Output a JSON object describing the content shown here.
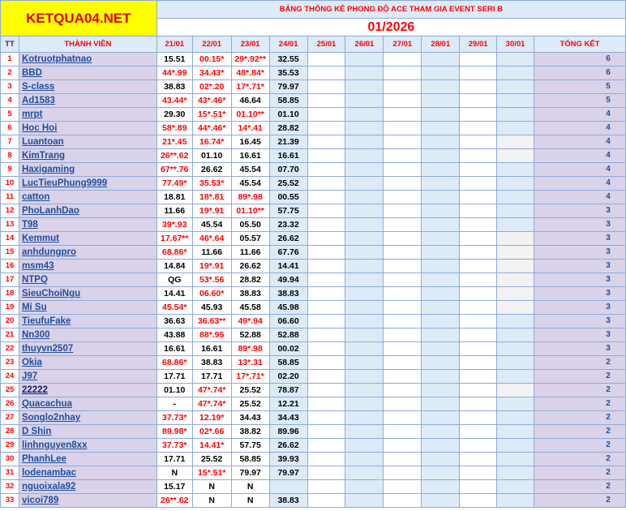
{
  "header": {
    "logo": "KETQUA04.NET",
    "title": "BẢNG THỐNG KÊ PHONG ĐỘ ACE THAM GIA EVENT SERI B",
    "month": "01/2026"
  },
  "columns": {
    "tt": "TT",
    "member": "THÀNH VIÊN",
    "dates": [
      "21/01",
      "22/01",
      "23/01",
      "24/01",
      "25/01",
      "26/01",
      "27/01",
      "28/01",
      "29/01",
      "30/01"
    ],
    "total": "TỔNG KẾT"
  },
  "rows": [
    {
      "tt": "1",
      "name": "Kotruotphatnao",
      "v": [
        "15.51",
        "00.15*",
        "29*.92**",
        "32.55"
      ],
      "total": "6"
    },
    {
      "tt": "2",
      "name": "BBD",
      "v": [
        "44*.99",
        "34.43*",
        "48*.84*",
        "35.53"
      ],
      "total": "6"
    },
    {
      "tt": "3",
      "name": "S-class",
      "v": [
        "38.83",
        "02*.20",
        "17*.71*",
        "79.97"
      ],
      "total": "5"
    },
    {
      "tt": "4",
      "name": "Ad1583",
      "v": [
        "43.44*",
        "43*.46*",
        "46.64",
        "58.85"
      ],
      "total": "5"
    },
    {
      "tt": "5",
      "name": "mrpt",
      "v": [
        "29.30",
        "15*.51*",
        "01.10**",
        "01.10"
      ],
      "total": "4"
    },
    {
      "tt": "6",
      "name": "Hoc Hoi",
      "v": [
        "58*.89",
        "44*.46*",
        "14*.41",
        "28.82"
      ],
      "total": "4"
    },
    {
      "tt": "7",
      "name": "Luantoan",
      "v": [
        "21*.45",
        "16.74*",
        "16.45",
        "21.39"
      ],
      "total": "4"
    },
    {
      "tt": "8",
      "name": "KimTrang",
      "v": [
        "26**.62",
        "01.10",
        "16.61",
        "16.61"
      ],
      "total": "4"
    },
    {
      "tt": "9",
      "name": "Haxigaming",
      "v": [
        "67**.76",
        "26.62",
        "45.54",
        "07.70"
      ],
      "total": "4"
    },
    {
      "tt": "10",
      "name": "LucTieuPhung9999",
      "v": [
        "77.49*",
        "35.53*",
        "45.54",
        "25.52"
      ],
      "total": "4"
    },
    {
      "tt": "11",
      "name": "catton",
      "v": [
        "18.81",
        "18*.81",
        "89*.98",
        "00.55"
      ],
      "total": "4"
    },
    {
      "tt": "12",
      "name": "PhoLanhDao",
      "v": [
        "11.66",
        "19*.91",
        "01.10**",
        "57.75"
      ],
      "total": "3"
    },
    {
      "tt": "13",
      "name": "T98",
      "v": [
        "39*.93",
        "45.54",
        "05.50",
        "23.32"
      ],
      "total": "3"
    },
    {
      "tt": "14",
      "name": "Kemmut",
      "v": [
        "17.67**",
        "46*.64",
        "05.57",
        "26.62"
      ],
      "total": "3"
    },
    {
      "tt": "15",
      "name": "anhdungpro",
      "v": [
        "68.86*",
        "11.66",
        "11.66",
        "67.76"
      ],
      "total": "3"
    },
    {
      "tt": "16",
      "name": "msm43",
      "v": [
        "14.84",
        "19*.91",
        "26.62",
        "14.41"
      ],
      "total": "3"
    },
    {
      "tt": "17",
      "name": "NTPQ",
      "v": [
        "QG",
        "53*.56",
        "28.82",
        "49.94"
      ],
      "total": "3"
    },
    {
      "tt": "18",
      "name": "SieuChoiNgu",
      "v": [
        "14.41",
        "06.60*",
        "38.83",
        "38.83"
      ],
      "total": "3"
    },
    {
      "tt": "19",
      "name": "Mi Su",
      "v": [
        "45.54*",
        "45.93",
        "45.58",
        "45.98"
      ],
      "total": "3"
    },
    {
      "tt": "20",
      "name": "TieufuFake",
      "v": [
        "36.63",
        "36.63**",
        "49*.94",
        "06.60"
      ],
      "total": "3"
    },
    {
      "tt": "21",
      "name": "Nn300",
      "v": [
        "43.88",
        "88*.95",
        "52.88",
        "52.88"
      ],
      "total": "3"
    },
    {
      "tt": "22",
      "name": "thuyvn2507",
      "v": [
        "16.61",
        "16.61",
        "89*.98",
        "00.02"
      ],
      "total": "3"
    },
    {
      "tt": "23",
      "name": "Okia",
      "v": [
        "68.86*",
        "38.83",
        "13*.31",
        "58.85"
      ],
      "total": "2"
    },
    {
      "tt": "24",
      "name": "J97",
      "v": [
        "17.71",
        "17.71",
        "17*.71*",
        "02.20"
      ],
      "total": "2"
    },
    {
      "tt": "25",
      "name": "22222",
      "v": [
        "01.10",
        "47*.74*",
        "25.52",
        "78.87"
      ],
      "total": "2"
    },
    {
      "tt": "26",
      "name": "Quacachua",
      "v": [
        "-",
        "47*.74*",
        "25.52",
        "12.21"
      ],
      "total": "2"
    },
    {
      "tt": "27",
      "name": "Songlo2nhay",
      "v": [
        "37.73*",
        "12.19*",
        "34.43",
        "34.43"
      ],
      "total": "2"
    },
    {
      "tt": "28",
      "name": "D Shin",
      "v": [
        "89.98*",
        "02*.66",
        "38.82",
        "89.96"
      ],
      "total": "2"
    },
    {
      "tt": "29",
      "name": "linhnguyen8xx",
      "v": [
        "37.73*",
        "14.41*",
        "57.75",
        "26.62"
      ],
      "total": "2"
    },
    {
      "tt": "30",
      "name": "PhanhLee",
      "v": [
        "17.71",
        "25.52",
        "58.85",
        "39.93"
      ],
      "total": "2"
    },
    {
      "tt": "31",
      "name": "lodenambac",
      "v": [
        "N",
        "15*.51*",
        "79.97",
        "79.97"
      ],
      "total": "2"
    },
    {
      "tt": "32",
      "name": "nguoixala92",
      "v": [
        "15.17",
        "N",
        "N",
        ""
      ],
      "total": "2"
    },
    {
      "tt": "33",
      "name": "vicoi789",
      "v": [
        "26**.62",
        "N",
        "N",
        "38.83"
      ],
      "total": "2"
    }
  ]
}
